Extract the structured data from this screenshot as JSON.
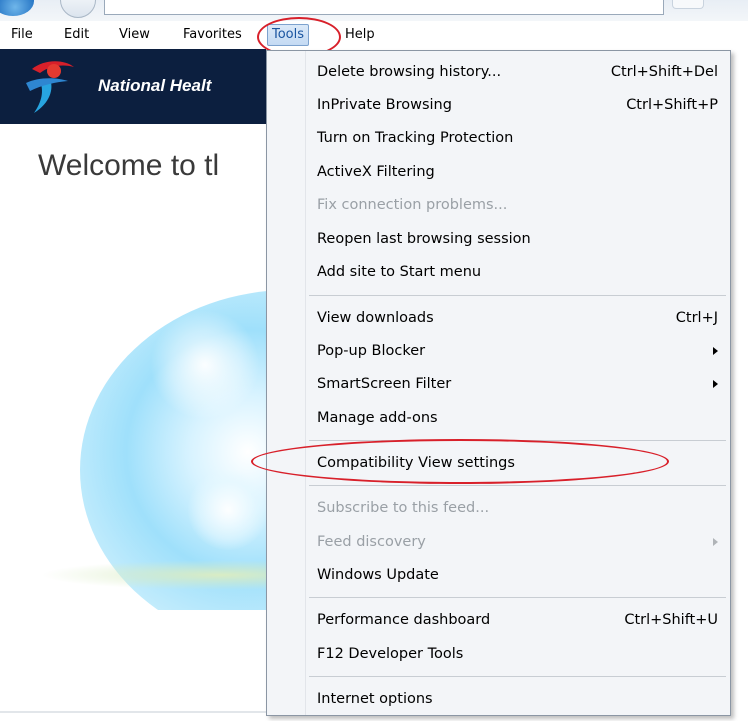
{
  "menubar": {
    "items": [
      {
        "label": "File"
      },
      {
        "label": "Edit"
      },
      {
        "label": "View"
      },
      {
        "label": "Favorites"
      },
      {
        "label": "Tools"
      },
      {
        "label": "Help"
      }
    ]
  },
  "page": {
    "banner_title": "National Healt",
    "welcome": "Welcome to tl"
  },
  "tools_menu": {
    "items": [
      {
        "label": "Delete browsing history...",
        "shortcut": "Ctrl+Shift+Del"
      },
      {
        "label": "InPrivate Browsing",
        "shortcut": "Ctrl+Shift+P"
      },
      {
        "label": "Turn on Tracking Protection"
      },
      {
        "label": "ActiveX Filtering"
      },
      {
        "label": "Fix connection problems..."
      },
      {
        "label": "Reopen last browsing session"
      },
      {
        "label": "Add site to Start menu"
      },
      {
        "label": "View downloads",
        "shortcut": "Ctrl+J"
      },
      {
        "label": "Pop-up Blocker"
      },
      {
        "label": "SmartScreen Filter"
      },
      {
        "label": "Manage add-ons"
      },
      {
        "label": "Compatibility View settings"
      },
      {
        "label": "Subscribe to this feed..."
      },
      {
        "label": "Feed discovery"
      },
      {
        "label": "Windows Update"
      },
      {
        "label": "Performance dashboard",
        "shortcut": "Ctrl+Shift+U"
      },
      {
        "label": "F12 Developer Tools"
      },
      {
        "label": "Internet options"
      }
    ]
  },
  "colors": {
    "annotation": "#d8202a",
    "banner": "#0c1f3f",
    "menu_bg": "#f3f5f8",
    "active_menu": "#1a55a0"
  }
}
